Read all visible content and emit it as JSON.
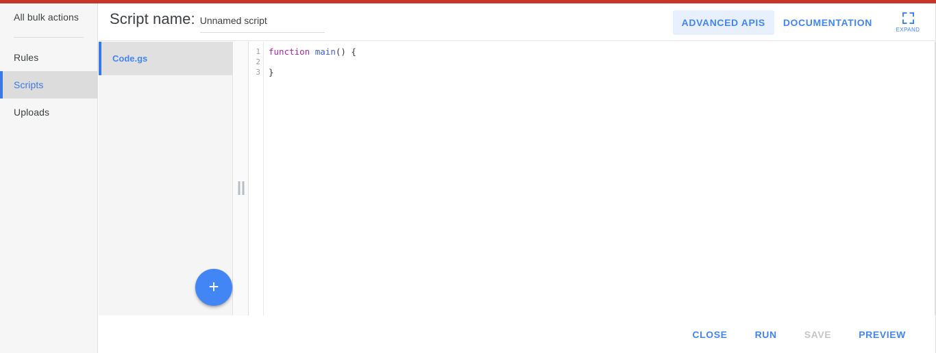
{
  "window": {
    "accent_color": "#c63527",
    "primary_blue": "#4285f4"
  },
  "sidebar": {
    "items": [
      {
        "label": "All bulk actions",
        "active": false
      },
      {
        "label": "Rules",
        "active": false
      },
      {
        "label": "Scripts",
        "active": true
      },
      {
        "label": "Uploads",
        "active": false
      }
    ]
  },
  "header": {
    "script_name_label": "Script name:",
    "script_name_value": "Unnamed script",
    "script_name_placeholder": "Unnamed script",
    "advanced_apis_label": "ADVANCED APIS",
    "documentation_label": "DOCUMENTATION",
    "expand_label": "EXPAND"
  },
  "file_panel": {
    "files": [
      {
        "name": "Code.gs",
        "active": true
      }
    ],
    "add_file_label": "+"
  },
  "editor": {
    "line_numbers": [
      "1",
      "2",
      "3"
    ],
    "lines": [
      {
        "kw": "function",
        "fn": "main",
        "punc": "() {"
      },
      {
        "kw": "",
        "fn": "",
        "punc": ""
      },
      {
        "kw": "",
        "fn": "",
        "punc": "}"
      }
    ],
    "full_text": "function main() {\n\n}"
  },
  "bottom_bar": {
    "buttons": [
      {
        "label": "CLOSE",
        "disabled": false
      },
      {
        "label": "RUN",
        "disabled": false
      },
      {
        "label": "SAVE",
        "disabled": true
      },
      {
        "label": "PREVIEW",
        "disabled": false
      }
    ]
  }
}
